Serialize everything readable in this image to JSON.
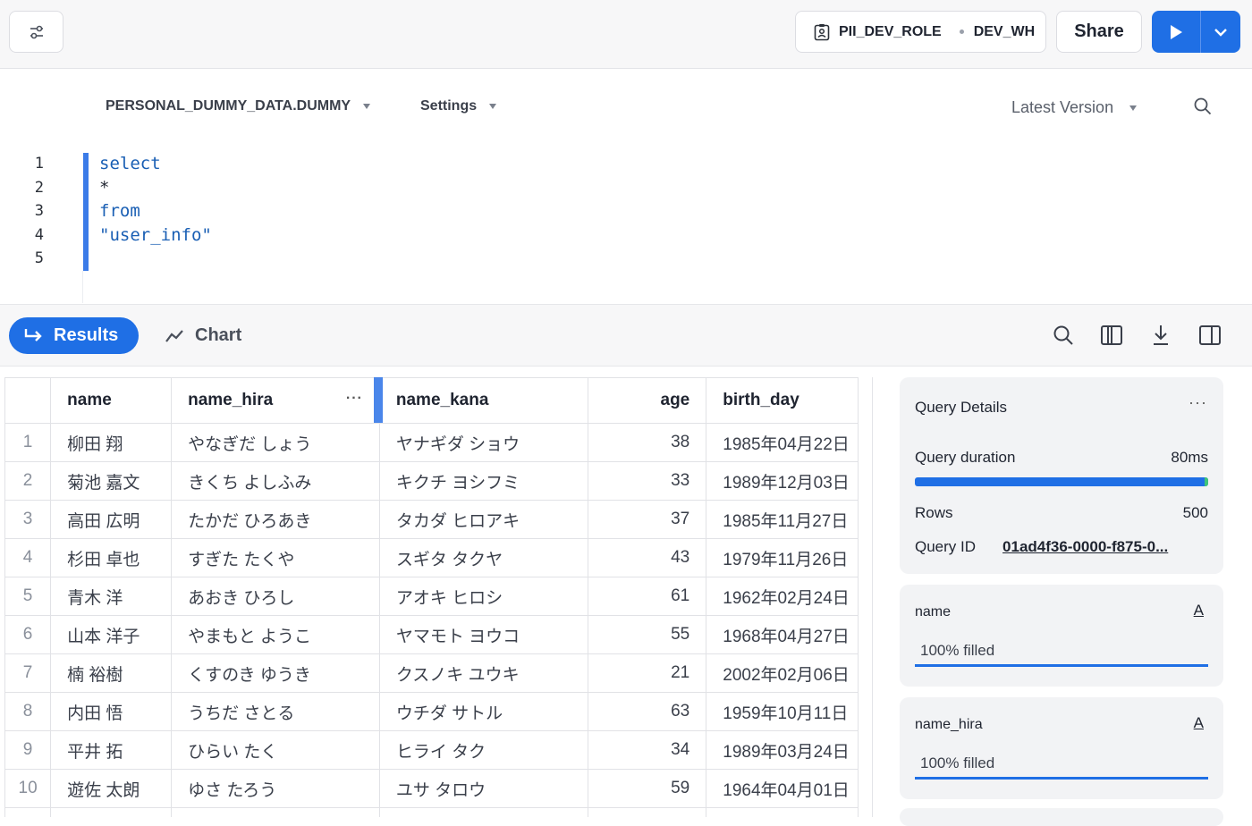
{
  "topbar": {
    "role": "PII_DEV_ROLE",
    "warehouse": "DEV_WH",
    "share_label": "Share"
  },
  "editor": {
    "database": "PERSONAL_DUMMY_DATA.DUMMY",
    "settings_label": "Settings",
    "version_label": "Latest Version",
    "line_numbers": [
      "1",
      "2",
      "3",
      "4",
      "5"
    ],
    "code_lines": [
      "select",
      "*",
      "from",
      "\"user_info\"",
      ""
    ]
  },
  "results": {
    "results_tab": "Results",
    "chart_tab": "Chart",
    "columns": [
      "",
      "name",
      "name_hira",
      "name_kana",
      "age",
      "birth_day"
    ],
    "rows": [
      [
        "1",
        "柳田 翔",
        "やなぎだ しょう",
        "ヤナギダ ショウ",
        "38",
        "1985年04月22日"
      ],
      [
        "2",
        "菊池 嘉文",
        "きくち よしふみ",
        "キクチ ヨシフミ",
        "33",
        "1989年12月03日"
      ],
      [
        "3",
        "高田 広明",
        "たかだ ひろあき",
        "タカダ ヒロアキ",
        "37",
        "1985年11月27日"
      ],
      [
        "4",
        "杉田 卓也",
        "すぎた たくや",
        "スギタ タクヤ",
        "43",
        "1979年11月26日"
      ],
      [
        "5",
        "青木 洋",
        "あおき ひろし",
        "アオキ ヒロシ",
        "61",
        "1962年02月24日"
      ],
      [
        "6",
        "山本 洋子",
        "やまもと ようこ",
        "ヤマモト ヨウコ",
        "55",
        "1968年04月27日"
      ],
      [
        "7",
        "楠 裕樹",
        "くすのき ゆうき",
        "クスノキ ユウキ",
        "21",
        "2002年02月06日"
      ],
      [
        "8",
        "内田 悟",
        "うちだ さとる",
        "ウチダ サトル",
        "63",
        "1959年10月11日"
      ],
      [
        "9",
        "平井 拓",
        "ひらい たく",
        "ヒライ タク",
        "34",
        "1989年03月24日"
      ],
      [
        "10",
        "遊佐 太朗",
        "ゆさ たろう",
        "ユサ タロウ",
        "59",
        "1964年04月01日"
      ]
    ]
  },
  "query_details": {
    "title": "Query Details",
    "duration_label": "Query duration",
    "duration_value": "80ms",
    "duration_fill": 1.0,
    "rows_label": "Rows",
    "rows_value": "500",
    "query_id_label": "Query ID",
    "query_id_value": "01ad4f36-0000-f875-0..."
  },
  "column_stats": [
    {
      "name": "name",
      "type": "A",
      "filled": "100% filled"
    },
    {
      "name": "name_hira",
      "type": "A",
      "filled": "100% filled"
    }
  ],
  "colors": {
    "accent": "#1f6fe5",
    "success_tip": "#3fc47a"
  }
}
